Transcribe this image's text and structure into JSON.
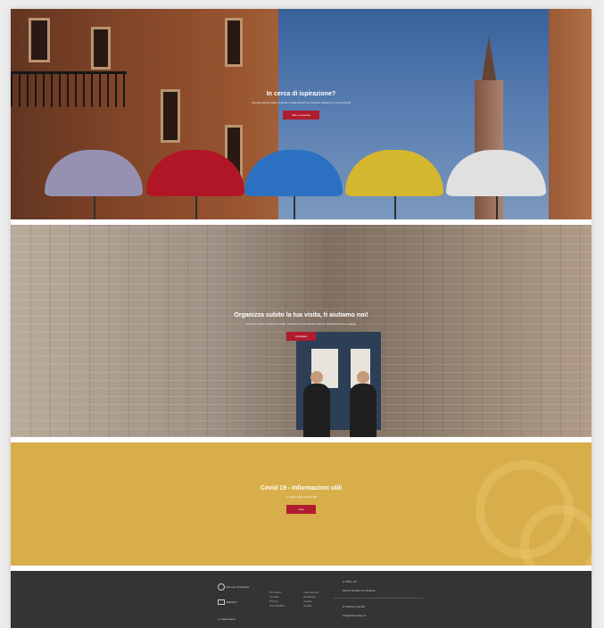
{
  "hero_inspiration": {
    "title": "In cerca di ispirazione?",
    "subtitle": "Lasciati ispirare dalle proposte e dagli itinerari per scoprire Modena e il suo territorio",
    "button_label": "Idee e proposte"
  },
  "hero_visit": {
    "title": "Organizza subito la tua visita, ti aiutiamo noi!",
    "subtitle": "Scopri le nostre proposte di visita, i servizi e le informazioni utili per organizzare il tuo viaggio",
    "button_label": "Contattaci"
  },
  "covid": {
    "title": "Covid 19 - Informazioni utili",
    "subtitle": "Le ultime informazioni utili",
    "button_label": "Vedi"
  },
  "footer": {
    "logo_city": "Comune di Modena",
    "logo_unesco": "UNESCO",
    "social_label": "visitmodena",
    "col1": [
      "Chi siamo",
      "Contatti",
      "Privacy",
      "Accessibilità"
    ],
    "col2": [
      "Area stampa",
      "Newsletter",
      "Cookie",
      "Credits"
    ],
    "contact_1_title": "Ufficio IAT",
    "contact_1_detail": "Piazza Grande 14, Modena",
    "contact_2_title": "Telefono e Email",
    "contact_2_detail": "info@visitmodena.it"
  },
  "colors": {
    "accent_red": "#b01c2e",
    "covid_yellow": "#d7ae49",
    "footer_dark": "#343434"
  }
}
